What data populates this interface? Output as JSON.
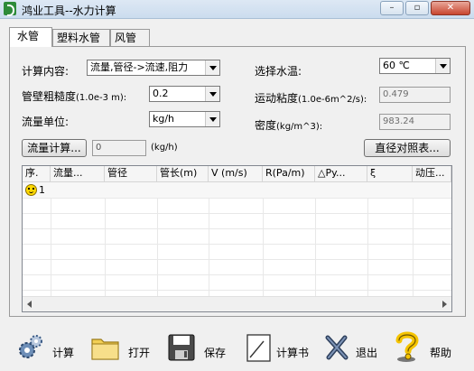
{
  "window": {
    "title": "鸿业工具--水力计算",
    "min_icon": "minimize-icon",
    "max_icon": "maximize-icon",
    "close_icon": "close-icon"
  },
  "tabs": [
    {
      "label": "水管",
      "active": true
    },
    {
      "label": "塑料水管",
      "active": false
    },
    {
      "label": "风管",
      "active": false
    }
  ],
  "form": {
    "calc_content_label": "计算内容:",
    "calc_content_value": "流量,管径->流速,阻力",
    "roughness_label": "管壁粗糙度",
    "roughness_unit": "(1.0e-3 m):",
    "roughness_value": "0.2",
    "flow_unit_label": "流量单位:",
    "flow_unit_value": "kg/h",
    "water_temp_label": "选择水温:",
    "water_temp_value": "60 ℃",
    "viscosity_label": "运动粘度",
    "viscosity_unit": "(1.0e-6m^2/s):",
    "viscosity_value": "0.479",
    "density_label": "密度",
    "density_unit": "(kg/m^3):",
    "density_value": "983.24",
    "flow_calc_button": "流量计算...",
    "flow_calc_value": "0",
    "flow_calc_unit": "(kg/h)",
    "diameter_table_button": "直径对照表..."
  },
  "grid": {
    "columns": [
      "序.",
      "流量...",
      "管径",
      "管长(m)",
      "V (m/s)",
      "R(Pa/m)",
      "△Py...",
      "ξ",
      "动压..."
    ],
    "rows": [
      {
        "row_icon": "smiley-icon",
        "index": "1"
      }
    ]
  },
  "toolbar": [
    {
      "icon": "gears-icon",
      "label": "计算"
    },
    {
      "icon": "folder-icon",
      "label": "打开"
    },
    {
      "icon": "floppy-disk-icon",
      "label": "保存"
    },
    {
      "icon": "calc-book-icon",
      "label": "计算书"
    },
    {
      "icon": "exit-x-icon",
      "label": "退出"
    },
    {
      "icon": "help-question-icon",
      "label": "帮助"
    }
  ],
  "colors": {
    "app_icon_green": "#2e8b3a",
    "smiley_yellow": "#ffd800",
    "folder_yellow": "#f2cf55",
    "help_yellow": "#f5c400"
  }
}
